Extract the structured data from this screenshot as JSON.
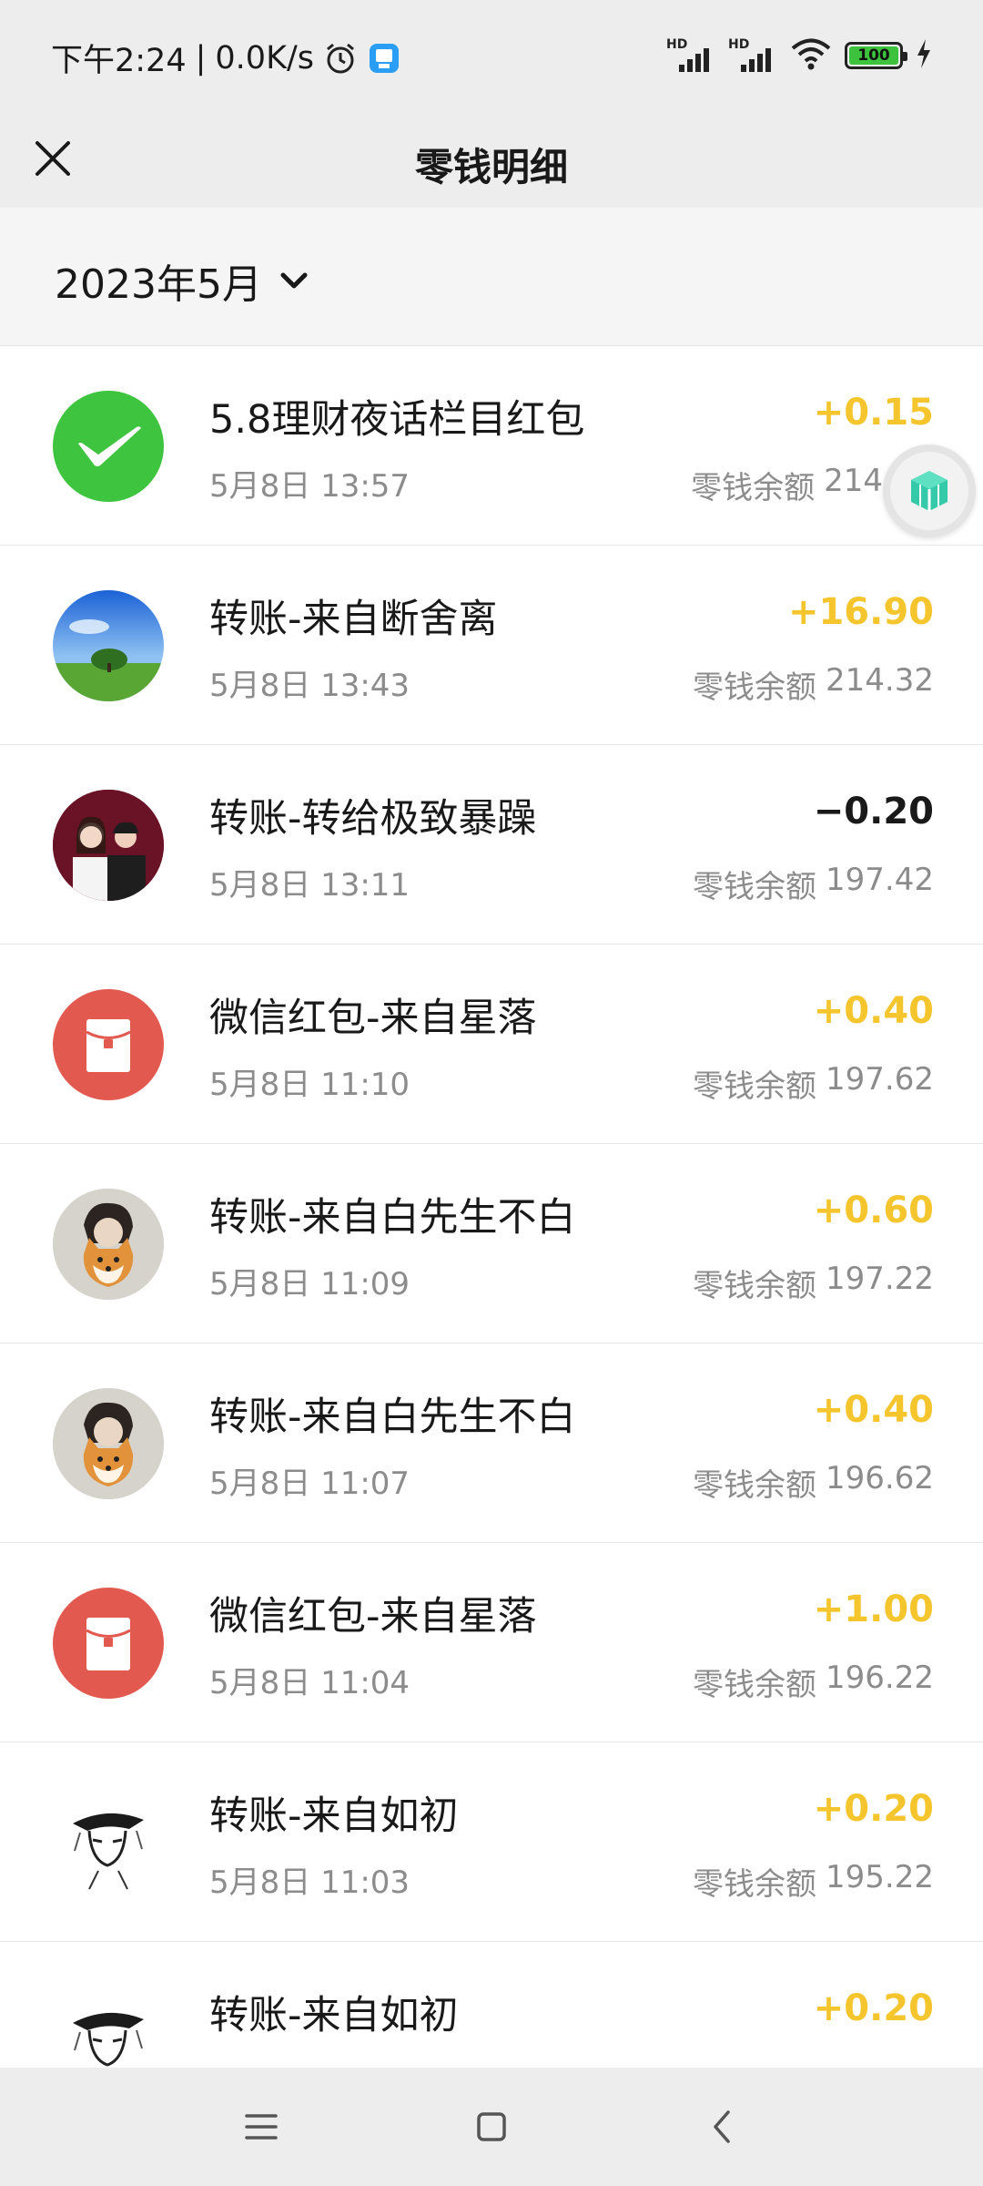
{
  "status_bar": {
    "time": "下午2:24",
    "network_speed": "0.0K/s",
    "signal_label_1": "HD",
    "signal_label_2": "HD",
    "battery": "100",
    "icons": [
      "alarm-icon",
      "app-notification-icon",
      "signal-icon",
      "signal-icon",
      "wifi-icon",
      "battery-icon",
      "charging-icon"
    ]
  },
  "header": {
    "title": "零钱明细",
    "close_icon": "close-icon"
  },
  "filter": {
    "month": "2023年5月",
    "dropdown_icon": "chevron-down-icon"
  },
  "colors": {
    "positive_amount": "#f5c52e",
    "negative_amount": "#191919",
    "wechat_green": "#3fc43f",
    "red_packet": "#e25a4f"
  },
  "balance_label": "零钱余额",
  "transactions": [
    {
      "title": "5.8理财夜话栏目红包",
      "time": "5月8日 13:57",
      "amount": "+0.15",
      "balance": "214",
      "avatar": "wechat-pay-icon"
    },
    {
      "title": "转账-来自断舍离",
      "time": "5月8日 13:43",
      "amount": "+16.90",
      "balance": "214.32",
      "avatar": "landscape-avatar"
    },
    {
      "title": "转账-转给极致暴躁",
      "time": "5月8日 13:11",
      "amount": "−0.20",
      "balance": "197.42",
      "avatar": "couple-avatar"
    },
    {
      "title": "微信红包-来自星落",
      "time": "5月8日 11:10",
      "amount": "+0.40",
      "balance": "197.62",
      "avatar": "red-packet-icon"
    },
    {
      "title": "转账-来自白先生不白",
      "time": "5月8日 11:09",
      "amount": "+0.60",
      "balance": "197.22",
      "avatar": "dog-avatar"
    },
    {
      "title": "转账-来自白先生不白",
      "time": "5月8日 11:07",
      "amount": "+0.40",
      "balance": "196.62",
      "avatar": "dog-avatar"
    },
    {
      "title": "微信红包-来自星落",
      "time": "5月8日 11:04",
      "amount": "+1.00",
      "balance": "196.22",
      "avatar": "red-packet-icon"
    },
    {
      "title": "转账-来自如初",
      "time": "5月8日 11:03",
      "amount": "+0.20",
      "balance": "195.22",
      "avatar": "sketch-avatar"
    },
    {
      "title": "转账-来自如初",
      "time": "",
      "amount": "+0.20",
      "balance": "",
      "avatar": "sketch-avatar"
    }
  ],
  "floating_button": {
    "icon": "cube-icon"
  },
  "system_nav": {
    "icons": [
      "menu-icon",
      "home-icon",
      "back-icon"
    ]
  }
}
